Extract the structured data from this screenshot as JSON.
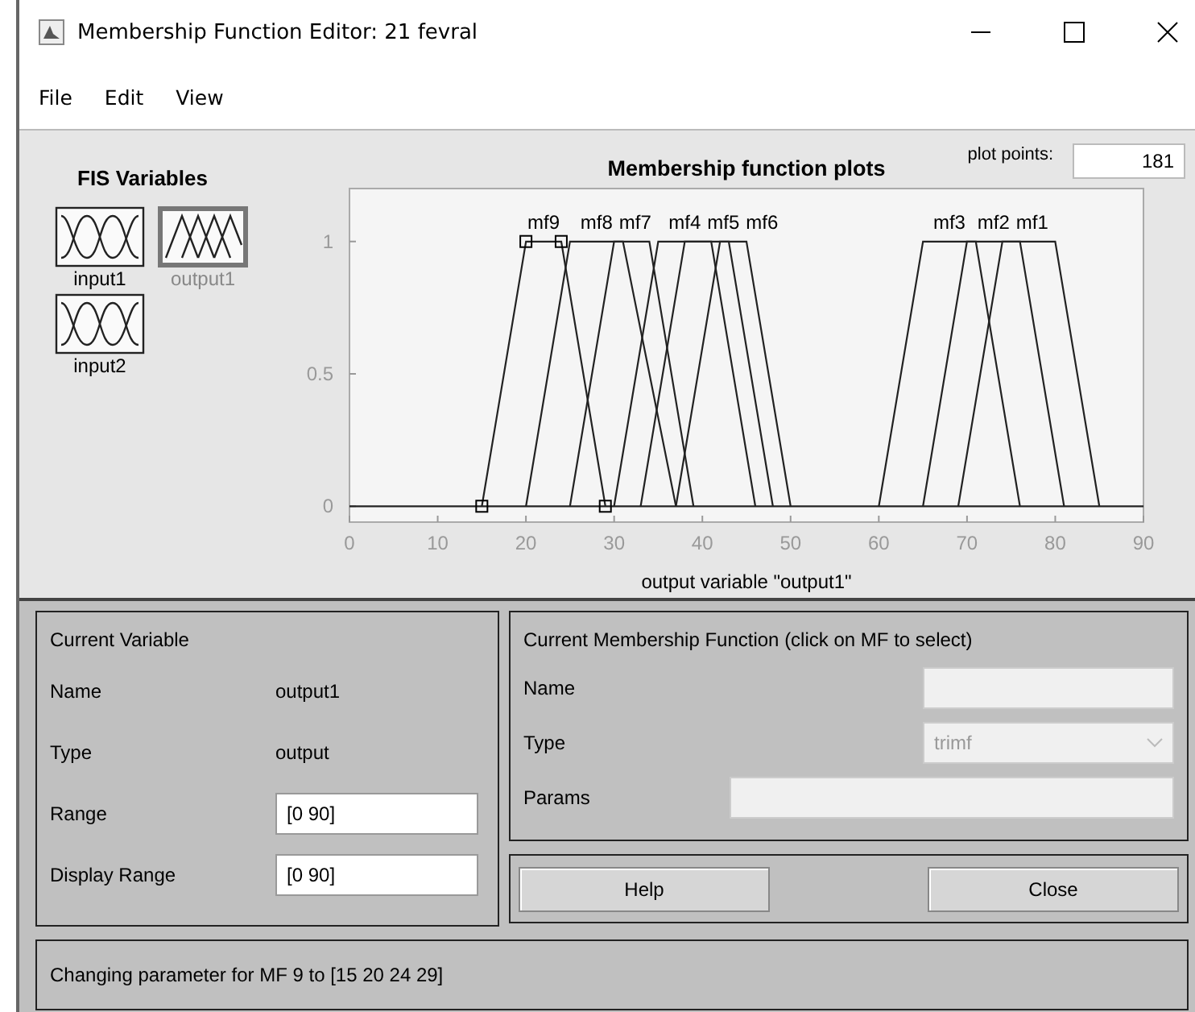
{
  "window": {
    "title": "Membership Function Editor: 21 fevral"
  },
  "menu": [
    "File",
    "Edit",
    "View"
  ],
  "fis_variables": {
    "heading": "FIS Variables",
    "items": [
      {
        "label": "input1",
        "kind": "input",
        "selected": false
      },
      {
        "label": "output1",
        "kind": "output",
        "selected": true
      },
      {
        "label": "input2",
        "kind": "input",
        "selected": false
      }
    ]
  },
  "plot": {
    "plot_points_label": "plot points:",
    "plot_points": "181",
    "chart_data": {
      "type": "line",
      "title": "Membership function plots",
      "xlabel": "output variable \"output1\"",
      "xlim": [
        0,
        90
      ],
      "ylim": [
        -0.06,
        1.2
      ],
      "xticks": [
        0,
        10,
        20,
        30,
        40,
        50,
        60,
        70,
        80,
        90
      ],
      "yticks": [
        0,
        0.5,
        1
      ],
      "series": [
        {
          "name": "mf9",
          "marker": true,
          "x": [
            15,
            20,
            24,
            29
          ],
          "values": [
            0,
            1,
            1,
            0
          ]
        },
        {
          "name": "mf8",
          "x": [
            20,
            25,
            31,
            37
          ],
          "values": [
            0,
            1,
            1,
            0
          ]
        },
        {
          "name": "mf7",
          "x": [
            25,
            30,
            34,
            39
          ],
          "values": [
            0,
            1,
            1,
            0
          ]
        },
        {
          "name": "mf4",
          "x": [
            30,
            35,
            41,
            46
          ],
          "values": [
            0,
            1,
            1,
            0
          ]
        },
        {
          "name": "mf5",
          "x": [
            33,
            38,
            43,
            48
          ],
          "values": [
            0,
            1,
            1,
            0
          ]
        },
        {
          "name": "mf6",
          "x": [
            37,
            42,
            45,
            50
          ],
          "values": [
            0,
            1,
            1,
            0
          ]
        },
        {
          "name": "mf3",
          "x": [
            60,
            65,
            71,
            76
          ],
          "values": [
            0,
            1,
            1,
            0
          ]
        },
        {
          "name": "mf2",
          "x": [
            65,
            70,
            76,
            81
          ],
          "values": [
            0,
            1,
            1,
            0
          ]
        },
        {
          "name": "mf1",
          "x": [
            69,
            74,
            80,
            85
          ],
          "values": [
            0,
            1,
            1,
            0
          ]
        }
      ]
    }
  },
  "current_variable": {
    "heading": "Current Variable",
    "name_label": "Name",
    "name": "output1",
    "type_label": "Type",
    "type": "output",
    "range_label": "Range",
    "range": "[0 90]",
    "display_range_label": "Display Range",
    "display_range": "[0 90]"
  },
  "current_mf": {
    "heading": "Current Membership Function (click on MF to select)",
    "name_label": "Name",
    "type_label": "Type",
    "type": "trimf",
    "disabled": true,
    "params_label": "Params"
  },
  "buttons": [
    "Help",
    "Close"
  ],
  "status": "Changing parameter for MF 9 to  [15 20 24 29]"
}
